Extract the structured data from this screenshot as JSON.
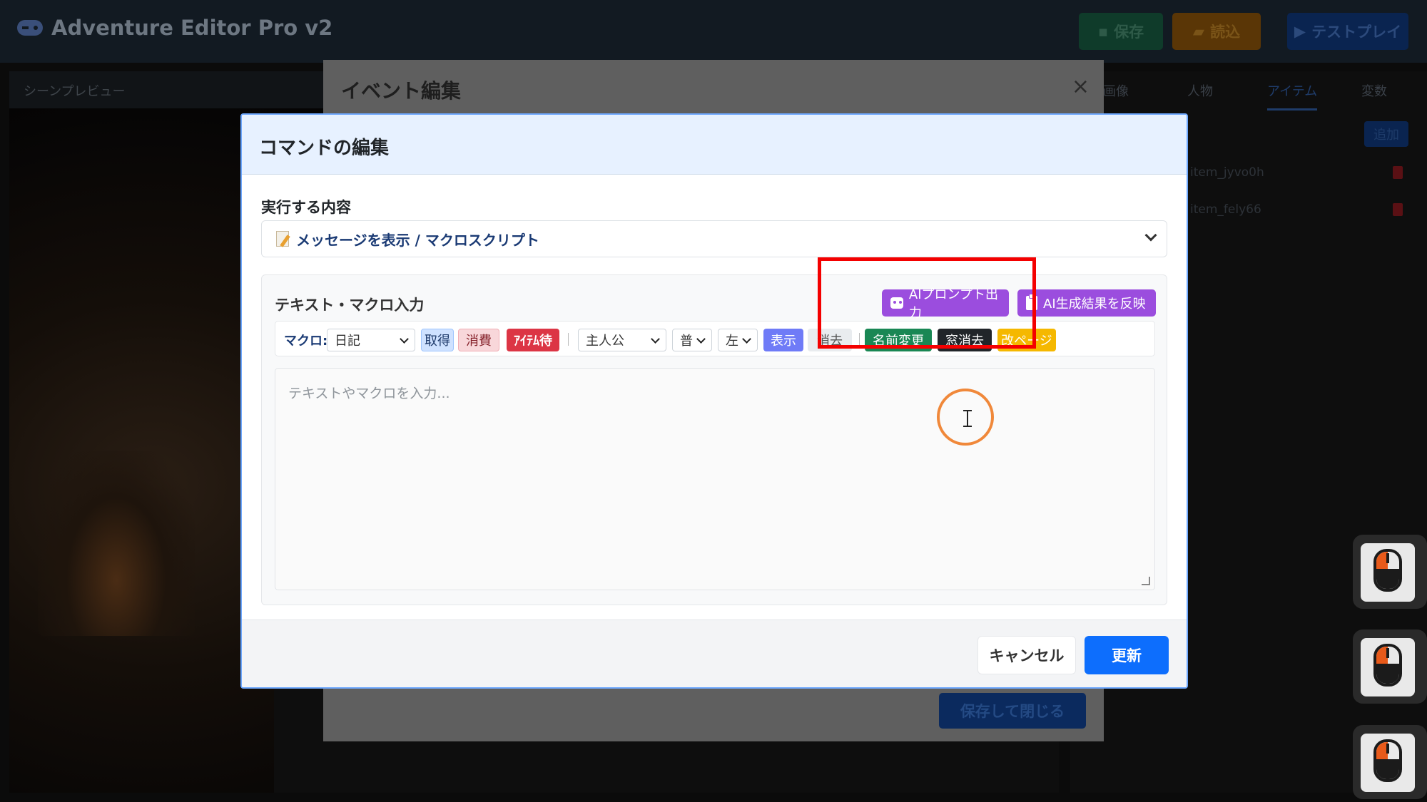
{
  "app": {
    "title": "Adventure Editor Pro v2",
    "buttons": {
      "save": "保存",
      "load": "読込",
      "testplay": "テストプレイ"
    },
    "colors": {
      "save": "#198754",
      "load": "#fd7e14",
      "testplay": "#0d6efd"
    }
  },
  "scene": {
    "title": "シーンプレビュー"
  },
  "right_panel": {
    "tabs": [
      "画像",
      "人物",
      "アイテム",
      "変数"
    ],
    "active_tab": "アイテム",
    "add_label": "追加",
    "items": [
      "item_jyvo0h",
      "item_fely66"
    ]
  },
  "event_modal": {
    "title": "イベント編集",
    "close": "×",
    "save_close": "保存して閉じる"
  },
  "command_modal": {
    "title": "コマンドの編集",
    "execute_label": "実行する内容",
    "selected_command": "メッセージを表示 / マクロスクリプト",
    "section_title": "テキスト・マクロ入力",
    "ai_prompt_button": "AIプロンプト出力",
    "ai_reflect_button": "AI生成結果を反映",
    "toolbar": {
      "label": "マクロ:",
      "diary_select": "日記",
      "acquire": "取得",
      "consume": "消費",
      "item_wait": "ｱｲﾃﾑ待",
      "character_select": "主人公",
      "expression_select": "普",
      "position_select": "左",
      "show": "表示",
      "erase": "消去",
      "rename": "名前変更",
      "window_erase": "窓消去",
      "page": "改ページ"
    },
    "textarea_placeholder": "テキストやマクロを入力...",
    "cancel": "キャンセル",
    "update": "更新"
  },
  "icons": [
    "gamepad-icon",
    "save-icon",
    "folder-icon",
    "play-icon",
    "memo-icon",
    "chevron-down-icon",
    "robot-icon",
    "clipboard-icon",
    "trash-icon",
    "close-icon",
    "text-cursor-icon",
    "mouse-left-click-icon"
  ]
}
